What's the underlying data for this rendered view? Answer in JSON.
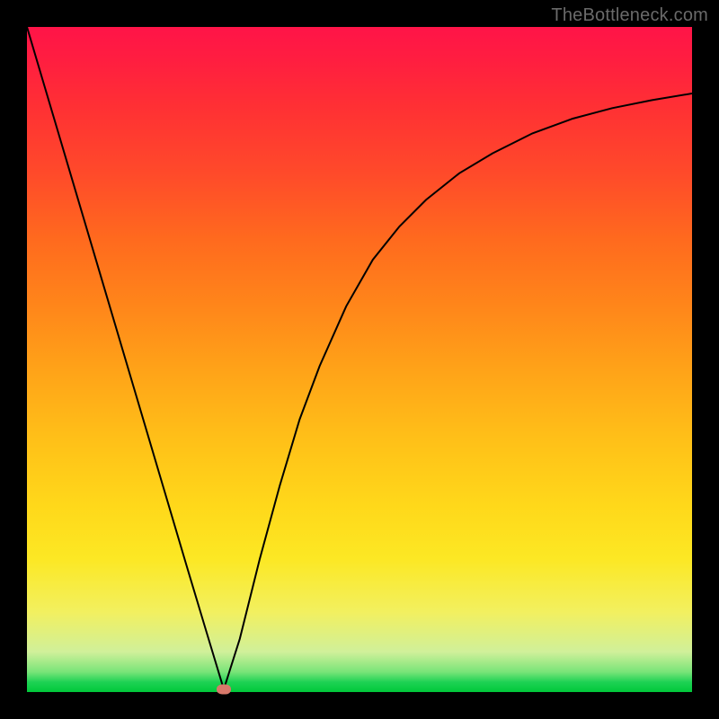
{
  "watermark": "TheBottleneck.com",
  "marker": {
    "x_frac": 0.296,
    "y_frac": 0.996,
    "color": "#d8786a"
  },
  "chart_data": {
    "type": "line",
    "title": "",
    "xlabel": "",
    "ylabel": "",
    "xlim": [
      0,
      1
    ],
    "ylim": [
      0,
      1
    ],
    "grid": false,
    "legend": false,
    "notes": "Bottleneck curve. No axis ticks or labels are rendered. Curve values are visual fractions (0–1). Higher y = lower on screen (bottom of gradient).",
    "series": [
      {
        "name": "bottleneck-curve",
        "x": [
          0.0,
          0.04,
          0.08,
          0.12,
          0.16,
          0.2,
          0.24,
          0.27,
          0.296,
          0.32,
          0.35,
          0.38,
          0.41,
          0.44,
          0.48,
          0.52,
          0.56,
          0.6,
          0.65,
          0.7,
          0.76,
          0.82,
          0.88,
          0.94,
          1.0
        ],
        "y": [
          0.0,
          0.135,
          0.27,
          0.405,
          0.54,
          0.675,
          0.81,
          0.91,
          0.996,
          0.92,
          0.8,
          0.69,
          0.59,
          0.51,
          0.42,
          0.35,
          0.3,
          0.26,
          0.22,
          0.19,
          0.16,
          0.138,
          0.122,
          0.11,
          0.1
        ]
      }
    ]
  },
  "colors": {
    "frame_bg": "#000000",
    "curve": "#000000"
  }
}
